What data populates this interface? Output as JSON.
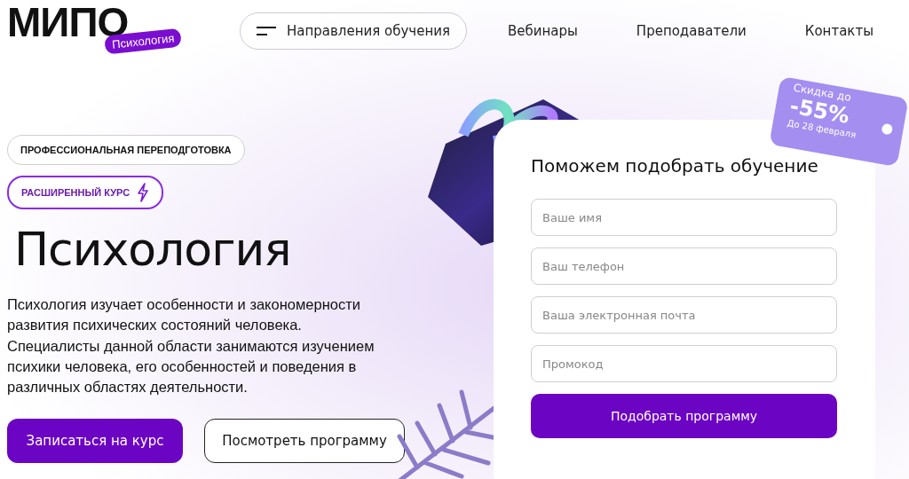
{
  "logo": {
    "wordmark": "МИПО",
    "badge": "Психология"
  },
  "nav": {
    "menu_button": "Направления обучения",
    "links": [
      "Вебинары",
      "Преподаватели",
      "Контакты"
    ]
  },
  "hero": {
    "tags": [
      {
        "label": "ПРОФЕССИОНАЛЬНАЯ ПЕРЕПОДГОТОВКА",
        "kind": "plain"
      },
      {
        "label": "РАСШИРЕННЫЙ КУРС",
        "kind": "accent"
      }
    ],
    "title": "Психология",
    "description": "Психология изучает особенности и закономерности развития психических состояний человека. Специалисты данной области занимаются изучением психики человека, его особенностей и поведения в различных областях деятельности.",
    "buttons": [
      {
        "label": "Записаться на курс",
        "kind": "primary"
      },
      {
        "label": "Посмотреть программу",
        "kind": "outline"
      }
    ]
  },
  "promo_tag": {
    "line_1": "Скидка до",
    "discount": "-55%",
    "line_2": "До 28 февраля"
  },
  "form": {
    "title": "Поможем подобрать обучение",
    "fields": [
      {
        "placeholder": "Ваше имя"
      },
      {
        "placeholder": "Ваш телефон"
      },
      {
        "placeholder": "Ваша электронная почта"
      },
      {
        "placeholder": "Промокод"
      }
    ],
    "submit": "Подобрать программу"
  }
}
